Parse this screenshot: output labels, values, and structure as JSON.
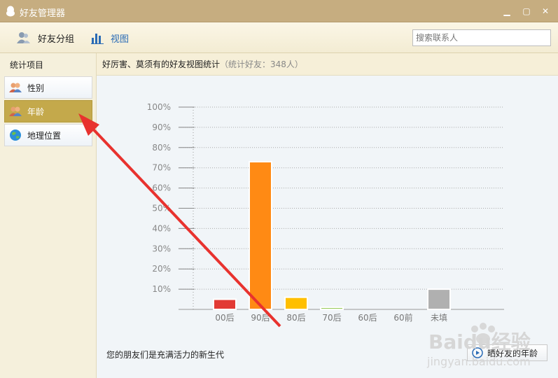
{
  "window": {
    "title": "好友管理器",
    "minimize": "▁",
    "maximize": "▢",
    "close": "✕"
  },
  "toolbar": {
    "groups_label": "好友分组",
    "view_label": "视图",
    "search_placeholder": "搜索联系人"
  },
  "sidebar": {
    "header": "统计项目",
    "items": [
      {
        "label": "性别",
        "active": false
      },
      {
        "label": "年龄",
        "active": true
      },
      {
        "label": "地理位置",
        "active": false
      }
    ]
  },
  "content": {
    "title": "好厉害、莫须有的好友视图统计",
    "subtitle": "（统计好友：348人）"
  },
  "chart_data": {
    "type": "bar",
    "categories": [
      "00后",
      "90后",
      "80后",
      "70后",
      "60后",
      "60前",
      "未填"
    ],
    "values": [
      5,
      73,
      6,
      1,
      0,
      0,
      10
    ],
    "colors": [
      "#e23a34",
      "#ff8a14",
      "#ffbf00",
      "#8ac43f",
      "#999999",
      "#999999",
      "#b0b0b0"
    ],
    "yticks": [
      "10%",
      "20%",
      "30%",
      "40%",
      "50%",
      "60%",
      "70%",
      "80%",
      "90%",
      "100%"
    ],
    "ylim": [
      0,
      100
    ],
    "grid": true
  },
  "footer": {
    "text": "您的朋友们是充满活力的新生代",
    "share_label": "晒好友的年龄"
  },
  "watermark": {
    "brand": "Baidu经验",
    "url": "jingyan.baidu.com"
  }
}
